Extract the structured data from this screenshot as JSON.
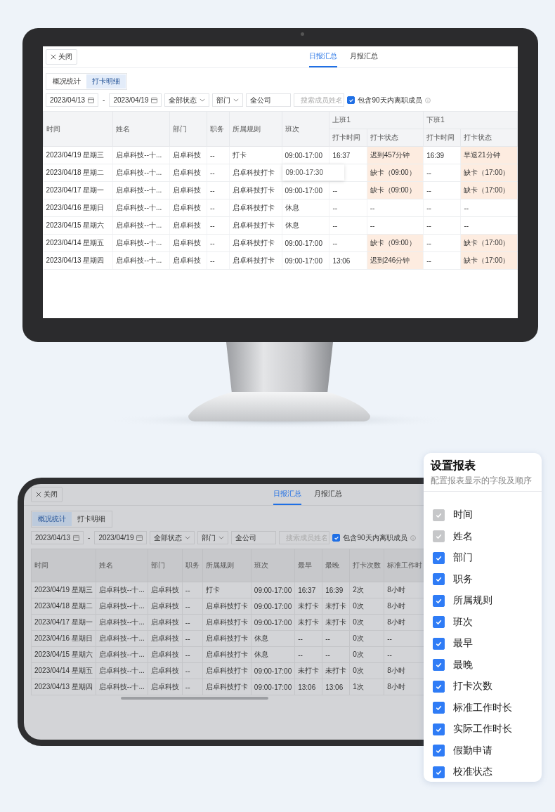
{
  "monitor": {
    "close_button": "关闭",
    "tabs": [
      {
        "label": "日报汇总",
        "selected": true
      },
      {
        "label": "月报汇总",
        "selected": false
      }
    ],
    "view_tabs": [
      {
        "label": "概况统计",
        "selected": false
      },
      {
        "label": "打卡明细",
        "selected": true
      }
    ],
    "filters": {
      "start_date": "2023/04/13",
      "separator": "-",
      "end_date": "2023/04/19",
      "status": "全部状态",
      "scope": "部门",
      "scope_value": "全公司",
      "search_placeholder": "搜索成员姓名",
      "include_left": {
        "label": "包含90天内离职成员",
        "checked": true
      }
    },
    "table": {
      "columns": [
        "时间",
        "姓名",
        "部门",
        "职务",
        "所属规则",
        "班次"
      ],
      "groups": [
        {
          "label": "上班1",
          "columns": [
            "打卡时间",
            "打卡状态"
          ]
        },
        {
          "label": "下班1",
          "columns": [
            "打卡时间",
            "打卡状态"
          ]
        }
      ],
      "rows": [
        {
          "cells": [
            "2023/04/19 星期三",
            "启卓科技--十...",
            "启卓科技",
            "--",
            "打卡",
            "09:00-17:00"
          ],
          "tooltip": "09:00-17:30",
          "punches": [
            {
              "time": "16:37",
              "status": "迟到457分钟",
              "alert": true
            },
            {
              "time": "16:39",
              "status": "早退21分钟",
              "alert": true
            }
          ]
        },
        {
          "cells": [
            "2023/04/18 星期二",
            "启卓科技--十...",
            "启卓科技",
            "--",
            "启卓科技打卡",
            null
          ],
          "punches": [
            {
              "status": "缺卡（09:00）",
              "alert": true
            },
            {
              "time": "--",
              "status": "缺卡（17:00）",
              "alert": true
            }
          ]
        },
        {
          "cells": [
            "2023/04/17 星期一",
            "启卓科技--十...",
            "启卓科技",
            "--",
            "启卓科技打卡",
            "09:00-17:00"
          ],
          "punches": [
            {
              "time": "--",
              "status": "缺卡（09:00）",
              "alert": true
            },
            {
              "time": "--",
              "status": "缺卡（17:00）",
              "alert": true
            }
          ]
        },
        {
          "cells": [
            "2023/04/16 星期日",
            "启卓科技--十...",
            "启卓科技",
            "--",
            "启卓科技打卡",
            "休息"
          ],
          "punches": [
            {
              "time": "--",
              "status": "--",
              "alert": false
            },
            {
              "time": "--",
              "status": "--",
              "alert": false
            }
          ]
        },
        {
          "cells": [
            "2023/04/15 星期六",
            "启卓科技--十...",
            "启卓科技",
            "--",
            "启卓科技打卡",
            "休息"
          ],
          "punches": [
            {
              "time": "--",
              "status": "--",
              "alert": false
            },
            {
              "time": "--",
              "status": "--",
              "alert": false
            }
          ]
        },
        {
          "cells": [
            "2023/04/14 星期五",
            "启卓科技--十...",
            "启卓科技",
            "--",
            "启卓科技打卡",
            "09:00-17:00"
          ],
          "punches": [
            {
              "time": "--",
              "status": "缺卡（09:00）",
              "alert": true
            },
            {
              "time": "--",
              "status": "缺卡（17:00）",
              "alert": true
            }
          ]
        },
        {
          "cells": [
            "2023/04/13 星期四",
            "启卓科技--十...",
            "启卓科技",
            "--",
            "启卓科技打卡",
            "09:00-17:00"
          ],
          "punches": [
            {
              "time": "13:06",
              "status": "迟到246分钟",
              "alert": true
            },
            {
              "time": "--",
              "status": "缺卡（17:00）",
              "alert": true
            }
          ]
        }
      ]
    }
  },
  "tablet": {
    "close_button": "关闭",
    "tabs": [
      {
        "label": "日报汇总",
        "selected": true
      },
      {
        "label": "月报汇总",
        "selected": false
      }
    ],
    "view_tabs": [
      {
        "label": "概况统计",
        "selected": true
      },
      {
        "label": "打卡明细",
        "selected": false
      }
    ],
    "filters": {
      "start_date": "2023/04/13",
      "separator": "-",
      "end_date": "2023/04/19",
      "status": "全部状态",
      "scope": "部门",
      "scope_value": "全公司",
      "search_placeholder": "搜索成员姓名",
      "include_left": {
        "label": "包含90天内离职成员",
        "checked": true
      }
    },
    "table": {
      "columns": [
        "时间",
        "姓名",
        "部门",
        "职务",
        "所属规则",
        "班次",
        "最早",
        "最晚",
        "打卡次数",
        "标准工作时"
      ],
      "rows": [
        [
          "2023/04/19 星期三",
          "启卓科技--十...",
          "启卓科技",
          "--",
          "打卡",
          "09:00-17:00",
          "16:37",
          "16:39",
          "2次",
          "8小时"
        ],
        [
          "2023/04/18 星期二",
          "启卓科技--十...",
          "启卓科技",
          "--",
          "启卓科技打卡",
          "09:00-17:00",
          "未打卡",
          "未打卡",
          "0次",
          "8小时"
        ],
        [
          "2023/04/17 星期一",
          "启卓科技--十...",
          "启卓科技",
          "--",
          "启卓科技打卡",
          "09:00-17:00",
          "未打卡",
          "未打卡",
          "0次",
          "8小时"
        ],
        [
          "2023/04/16 星期日",
          "启卓科技--十...",
          "启卓科技",
          "--",
          "启卓科技打卡",
          "休息",
          "--",
          "--",
          "0次",
          "--"
        ],
        [
          "2023/04/15 星期六",
          "启卓科技--十...",
          "启卓科技",
          "--",
          "启卓科技打卡",
          "休息",
          "--",
          "--",
          "0次",
          "--"
        ],
        [
          "2023/04/14 星期五",
          "启卓科技--十...",
          "启卓科技",
          "--",
          "启卓科技打卡",
          "09:00-17:00",
          "未打卡",
          "未打卡",
          "0次",
          "8小时"
        ],
        [
          "2023/04/13 星期四",
          "启卓科技--十...",
          "启卓科技",
          "--",
          "启卓科技打卡",
          "09:00-17:00",
          "13:06",
          "13:06",
          "1次",
          "8小时"
        ]
      ]
    }
  },
  "settings_panel": {
    "title": "设置报表",
    "subtitle": "配置报表显示的字段及顺序",
    "fields": [
      {
        "label": "时间",
        "checked": true,
        "disabled": true
      },
      {
        "label": "姓名",
        "checked": true,
        "disabled": true
      },
      {
        "label": "部门",
        "checked": true,
        "disabled": false
      },
      {
        "label": "职务",
        "checked": true,
        "disabled": false
      },
      {
        "label": "所属规则",
        "checked": true,
        "disabled": false
      },
      {
        "label": "班次",
        "checked": true,
        "disabled": false
      },
      {
        "label": "最早",
        "checked": true,
        "disabled": false
      },
      {
        "label": "最晚",
        "checked": true,
        "disabled": false
      },
      {
        "label": "打卡次数",
        "checked": true,
        "disabled": false
      },
      {
        "label": "标准工作时长",
        "checked": true,
        "disabled": false
      },
      {
        "label": "实际工作时长",
        "checked": true,
        "disabled": false
      },
      {
        "label": "假勤申请",
        "checked": true,
        "disabled": false
      },
      {
        "label": "校准状态",
        "checked": true,
        "disabled": false
      }
    ]
  }
}
